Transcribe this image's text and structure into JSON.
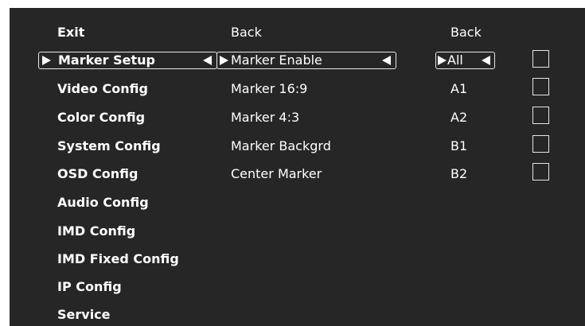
{
  "menu": {
    "items": [
      {
        "label": "Exit"
      },
      {
        "label": "Marker Setup"
      },
      {
        "label": "Video Config"
      },
      {
        "label": "Color Config"
      },
      {
        "label": "System Config"
      },
      {
        "label": "OSD Config"
      },
      {
        "label": "Audio Config"
      },
      {
        "label": "IMD Config"
      },
      {
        "label": "IMD Fixed Config"
      },
      {
        "label": "IP Config"
      },
      {
        "label": "Service"
      }
    ]
  },
  "submenu": {
    "items": [
      {
        "label": "Back"
      },
      {
        "label": "Marker Enable"
      },
      {
        "label": "Marker 16:9"
      },
      {
        "label": "Marker 4:3"
      },
      {
        "label": "Marker Backgrd"
      },
      {
        "label": "Center Marker"
      }
    ]
  },
  "options": {
    "items": [
      {
        "label": "Back"
      },
      {
        "label": "All"
      },
      {
        "label": "A1"
      },
      {
        "label": "A2"
      },
      {
        "label": "B1"
      },
      {
        "label": "B2"
      }
    ]
  },
  "checkboxes": [
    {
      "checked": false
    },
    {
      "checked": false
    },
    {
      "checked": false
    },
    {
      "checked": false
    },
    {
      "checked": false
    }
  ],
  "colors": {
    "background": "#262626",
    "text": "#ffffff",
    "selection_border": "#e8e8e8"
  },
  "icons": {
    "selection_left": "triangle-right-icon",
    "selection_right": "triangle-left-icon"
  }
}
